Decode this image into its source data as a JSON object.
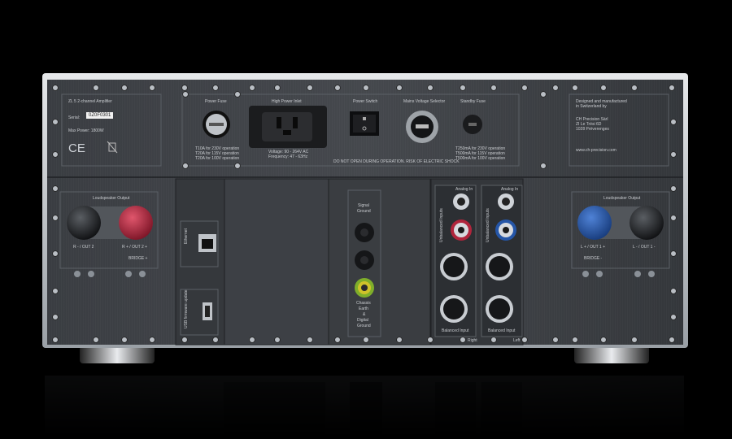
{
  "top_left": {
    "model": "ZL 5 2-channel Amplifier",
    "serial_label": "Serial:",
    "serial_value": "0Z0F0301",
    "max_power": "Max Power: 1800W",
    "ce_mark": "CE"
  },
  "top_center": {
    "power_fuse": "Power Fuse",
    "high_power_inlet": "High Power Inlet",
    "power_switch": "Power Switch",
    "mains_voltage_selector": "Mains Voltage Selector",
    "standby_fuse": "Standby Fuse",
    "fuse_ratings": [
      "T10A for 230V operation",
      "T20A for 115V operation",
      "T20A for 100V operation"
    ],
    "inlet_ratings": [
      "Voltage: 90 - 264V AC",
      "Frequency: 47 - 63Hz"
    ],
    "warning": "DO NOT OPEN DURING OPERATION. RISK OF ELECTRIC SHOCK",
    "standby_ratings": [
      "T250mA for 230V operation",
      "T500mA for 115V operation",
      "T500mA for 100V operation"
    ]
  },
  "top_right": {
    "lines": [
      "Designed and manufactured",
      "in Switzerland by",
      "",
      "CH Precision Sàrl",
      "ZI Le Trési 6D",
      "1028 Préverenges",
      "",
      "www.ch-precision.com"
    ]
  },
  "left_output": {
    "title": "Loudspeaker Output",
    "neg_label": "R - / OUT 2",
    "pos_label": "R + / OUT 2 +",
    "bridge": "BRIDGE +",
    "colors": {
      "neg": "#1a1c1f",
      "pos": "#b0253c"
    }
  },
  "right_output": {
    "title": "Loudspeaker Output",
    "pos_label": "L + / OUT 1 +",
    "neg_label": "L - / OUT 1 -",
    "bridge": "BRIDGE -",
    "colors": {
      "pos": "#2556a8",
      "neg": "#1a1c1f"
    }
  },
  "ethernet": {
    "label": "Ethernet"
  },
  "usb": {
    "label": "USB firmware update"
  },
  "ground": {
    "title_lines": [
      "Signal",
      "Ground"
    ],
    "chassis_lines": [
      "Chassis",
      "Earth",
      "&",
      "Digital",
      "Ground"
    ],
    "colors": {
      "chassis_ring": "#7fae2a"
    }
  },
  "inputs": {
    "analog_in": "Analog In",
    "unbalanced": "Unbalanced Inputs",
    "balanced": "Balanced Input",
    "right": "Right",
    "left": "Left",
    "colors": {
      "right_ring": "#b0253c",
      "left_ring": "#2556a8"
    }
  }
}
